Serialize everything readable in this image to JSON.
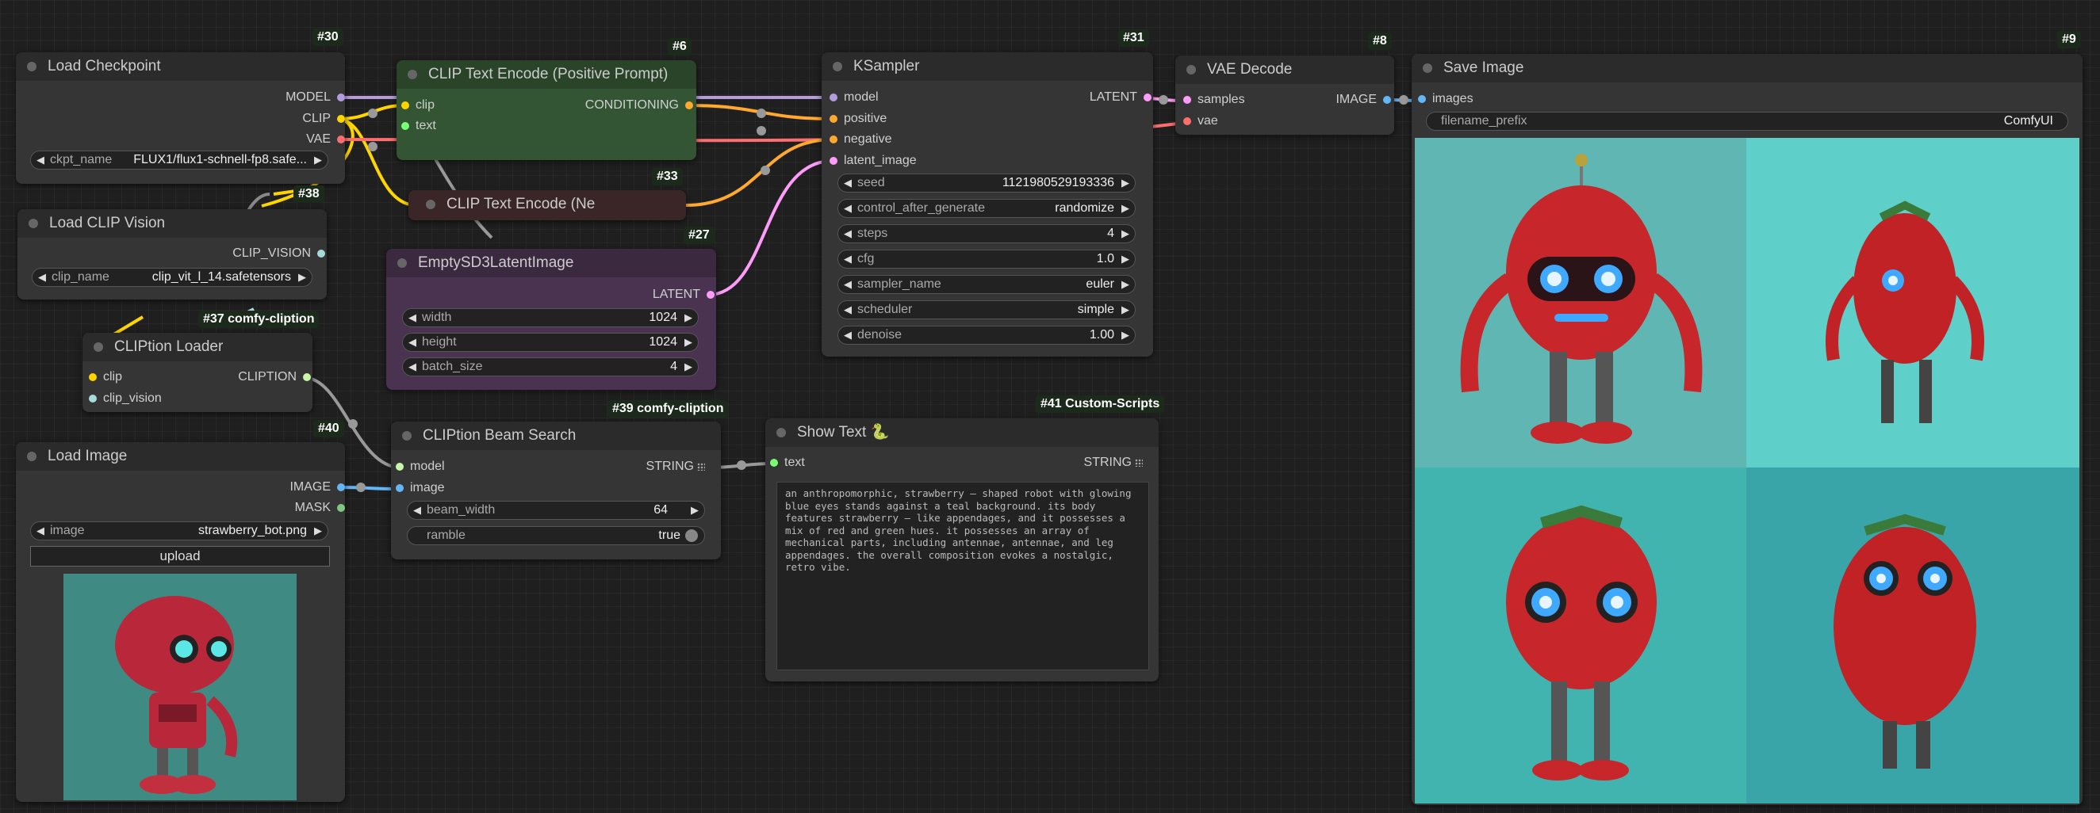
{
  "colors": {
    "model": "#b39ddb",
    "clip": "#ffd500",
    "vae": "#ff6e6e",
    "conditioning": "#ffa931",
    "latent": "#ff9cf9",
    "image": "#64b5f6",
    "mask": "#81c784",
    "clip_vision": "#a8dadc",
    "cliption": "#c9f7a9",
    "string": "#77ff77",
    "text_in": "#77ff77",
    "gray_wire": "#999999"
  },
  "nodes": {
    "load_checkpoint": {
      "id": "#30",
      "title": "Load Checkpoint",
      "outputs": [
        "MODEL",
        "CLIP",
        "VAE"
      ],
      "ckpt_name_label": "ckpt_name",
      "ckpt_name_value": "FLUX1/flux1-schnell-fp8.safe..."
    },
    "clip_text_pos": {
      "id": "#6",
      "title": "CLIP Text Encode (Positive Prompt)",
      "inputs": [
        "clip",
        "text"
      ],
      "output": "CONDITIONING"
    },
    "clip_text_neg": {
      "id": "#33",
      "title": "CLIP Text Encode (Ne"
    },
    "empty_latent": {
      "id": "#27",
      "title": "EmptySD3LatentImage",
      "output": "LATENT",
      "widgets": [
        {
          "label": "width",
          "value": "1024"
        },
        {
          "label": "height",
          "value": "1024"
        },
        {
          "label": "batch_size",
          "value": "4"
        }
      ]
    },
    "ksampler": {
      "id": "#31",
      "title": "KSampler",
      "inputs": [
        "model",
        "positive",
        "negative",
        "latent_image"
      ],
      "output": "LATENT",
      "widgets": [
        {
          "label": "seed",
          "value": "1121980529193336"
        },
        {
          "label": "control_after_generate",
          "value": "randomize"
        },
        {
          "label": "steps",
          "value": "4"
        },
        {
          "label": "cfg",
          "value": "1.0"
        },
        {
          "label": "sampler_name",
          "value": "euler"
        },
        {
          "label": "scheduler",
          "value": "simple"
        },
        {
          "label": "denoise",
          "value": "1.00"
        }
      ]
    },
    "vae_decode": {
      "id": "#8",
      "title": "VAE Decode",
      "inputs": [
        "samples",
        "vae"
      ],
      "output": "IMAGE"
    },
    "save_image": {
      "id": "#9",
      "title": "Save Image",
      "input": "images",
      "prefix_label": "filename_prefix",
      "prefix_value": "ComfyUI"
    },
    "load_clip_vision": {
      "id": "#38",
      "title": "Load CLIP Vision",
      "output": "CLIP_VISION",
      "clip_name_label": "clip_name",
      "clip_name_value": "clip_vit_l_14.safetensors"
    },
    "cliption_loader": {
      "id": "#37 comfy-cliption",
      "title": "CLIPtion Loader",
      "inputs": [
        "clip",
        "clip_vision"
      ],
      "output": "CLIPTION"
    },
    "load_image": {
      "id": "#40",
      "title": "Load Image",
      "outputs": [
        "IMAGE",
        "MASK"
      ],
      "image_label": "image",
      "image_value": "strawberry_bot.png",
      "upload_label": "upload"
    },
    "cliption_beam": {
      "id": "#39 comfy-cliption",
      "title": "CLIPtion Beam Search",
      "inputs": [
        "model",
        "image"
      ],
      "output": "STRING",
      "beam_width_label": "beam_width",
      "beam_width_value": "64",
      "ramble_label": "ramble",
      "ramble_value": "true"
    },
    "show_text": {
      "id": "#41 Custom-Scripts",
      "title": "Show Text 🐍",
      "input": "text",
      "output": "STRING",
      "content": "an anthropomorphic, strawberry – shaped robot with glowing blue eyes stands against a teal background. its body features strawberry – like appendages, and it possesses a mix of red and green hues. it possesses an array of mechanical parts, including antennae, antennae, and leg appendages. the overall composition evokes a nostalgic, retro vibe."
    }
  }
}
